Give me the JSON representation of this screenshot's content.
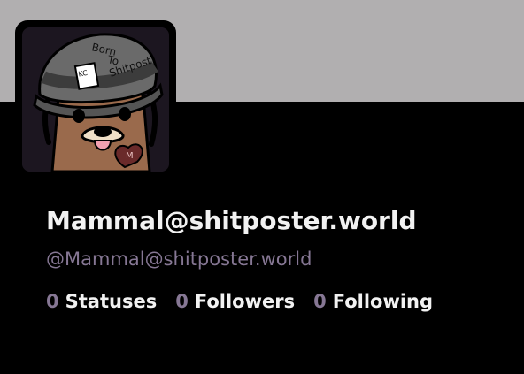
{
  "profile": {
    "display_name": "Mammal@shitposter.world",
    "handle": "@Mammal@shitposter.world",
    "avatar": {
      "icon": "mole-with-helmet-avatar",
      "helmet_text": [
        "Born",
        "To",
        "Shitpost"
      ],
      "patch_text": "KC",
      "heart_text": "M"
    }
  },
  "stats": [
    {
      "count": "0",
      "label": "Statuses"
    },
    {
      "count": "0",
      "label": "Followers"
    },
    {
      "count": "0",
      "label": "Following"
    }
  ],
  "colors": {
    "banner": "#b1afb0",
    "background": "#000000",
    "text": "#f2f2f2",
    "accent": "#867794"
  }
}
